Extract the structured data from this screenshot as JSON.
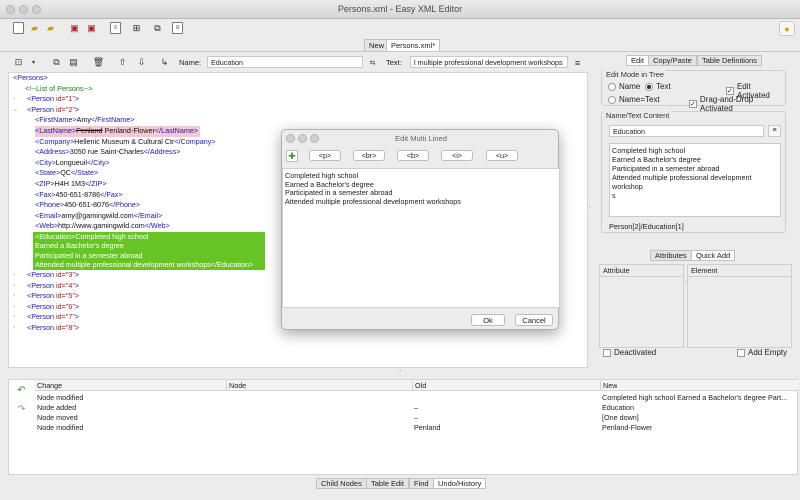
{
  "window": {
    "title": "Persons.xml - Easy XML Editor"
  },
  "doc_tabs": [
    "New",
    "Persons.xml*"
  ],
  "editor_toolbar": {
    "name_label": "Name:",
    "name_value": "Education",
    "text_label": "Text:",
    "text_value": "l multiple professional development workshops"
  },
  "tree": {
    "root_open": "<Persons>",
    "comment": "<!--List of Persons-->",
    "person1": {
      "tag": "<Person ",
      "attr": "id=",
      "val": "\"1\"",
      "close": ">"
    },
    "person2": {
      "tag": "<Person ",
      "attr": "id=",
      "val": "\"2\"",
      "close": ">"
    },
    "firstname": {
      "open": "<FirstName>",
      "text": "Amy",
      "close": "</FirstName>"
    },
    "lastname": {
      "open": "<LastName>",
      "old": "Penland",
      "new": " Penland-Flower",
      "close": "</LastName>"
    },
    "company": {
      "open": "<Company>",
      "text": "Hellenic Museum & Cultural Ctr",
      "close": "</Company>"
    },
    "address": {
      "open": "<Address>",
      "text": "3050 rue Saint-Charles",
      "close": "</Address>"
    },
    "city": {
      "open": "<City>",
      "text": "Longueuil",
      "close": "</City>"
    },
    "state": {
      "open": "<State>",
      "text": "QC",
      "close": "</State>"
    },
    "zip": {
      "open": "<ZIP>",
      "text": "H4H 1M3",
      "close": "</ZIP>"
    },
    "fax": {
      "open": "<Fax>",
      "text": "450-651-8786",
      "close": "</Fax>"
    },
    "phone": {
      "open": "<Phone>",
      "text": "450-651-8076",
      "close": "</Phone>"
    },
    "email": {
      "open": "<Email>",
      "text": "amy@gamingwild.com",
      "close": "</Email>"
    },
    "web": {
      "open": "<Web>",
      "text": "http://www.gamingwild.com",
      "close": "</Web>"
    },
    "education_lines": [
      "<Education>Completed high school",
      "Earned a Bachelor's degree",
      "Participated in a semester abroad",
      "Attended multiple professional development workshops</Education>"
    ],
    "persons_rest": [
      {
        "tag": "<Person ",
        "attr": "id=",
        "val": "\"3\"",
        "close": ">"
      },
      {
        "tag": "<Person ",
        "attr": "id=",
        "val": "\"4\"",
        "close": ">"
      },
      {
        "tag": "<Person ",
        "attr": "id=",
        "val": "\"5\"",
        "close": ">"
      },
      {
        "tag": "<Person ",
        "attr": "id=",
        "val": "\"6\"",
        "close": ">"
      },
      {
        "tag": "<Person ",
        "attr": "id=",
        "val": "\"7\"",
        "close": ">"
      },
      {
        "tag": "<Person ",
        "attr": "id=",
        "val": "\"8\"",
        "close": ">"
      }
    ]
  },
  "right_panel": {
    "tabs": [
      "Edit",
      "Copy/Paste",
      "Table Definitions"
    ],
    "edit_mode": {
      "title": "Edit Mode in Tree",
      "name": "Name",
      "text": "Text",
      "name_text": "Name=Text",
      "edit_activated": "Edit Activated",
      "drag_drop": "Drag-and-Drop Activated"
    },
    "name_text_content": {
      "title": "Name/Text Content",
      "name_value": "Education",
      "text_value": [
        "Completed high school",
        "Earned a Bachelor's degree",
        "Participated in a semester abroad",
        "Attended multiple professional development workshop",
        "s"
      ],
      "path": "Person[2]/Education[1]"
    },
    "attr_tabs": [
      "Attributes",
      "Quick Add"
    ],
    "attr_headers": [
      "Attribute",
      "Element"
    ],
    "deactivated": "Deactivated",
    "add_empty": "Add Empty"
  },
  "dialog": {
    "title": "Edit Multi Lined",
    "buttons": [
      "<p>",
      "<br>",
      "<b>",
      "<i>",
      "<u>"
    ],
    "text_lines": [
      "Completed high school",
      "Earned a Bachelor's degree",
      "Participated in a semester abroad",
      "Attended multiple professional development workshops"
    ],
    "ok": "Ok",
    "cancel": "Cancel"
  },
  "history": {
    "headers": [
      "Change",
      "Node",
      "Old",
      "New"
    ],
    "rows": [
      [
        "Node modified",
        "",
        "",
        "Completed high school Earned a Bachelor's degree Part..."
      ],
      [
        "Node added",
        "",
        "–",
        "Education"
      ],
      [
        "Node moved",
        "",
        "–",
        "[One down]"
      ],
      [
        "Node modified",
        "",
        "Penland",
        "Penland-Flower"
      ]
    ]
  },
  "bottom_tabs": [
    "Child Nodes",
    "Table Edit",
    "Find",
    "Undo/History"
  ],
  "colors": {
    "tag": "#1a1ab0",
    "attr_name": "#b01a1a",
    "comment": "#168016",
    "selection": "#66c524",
    "modified": "#f6c8d2"
  }
}
